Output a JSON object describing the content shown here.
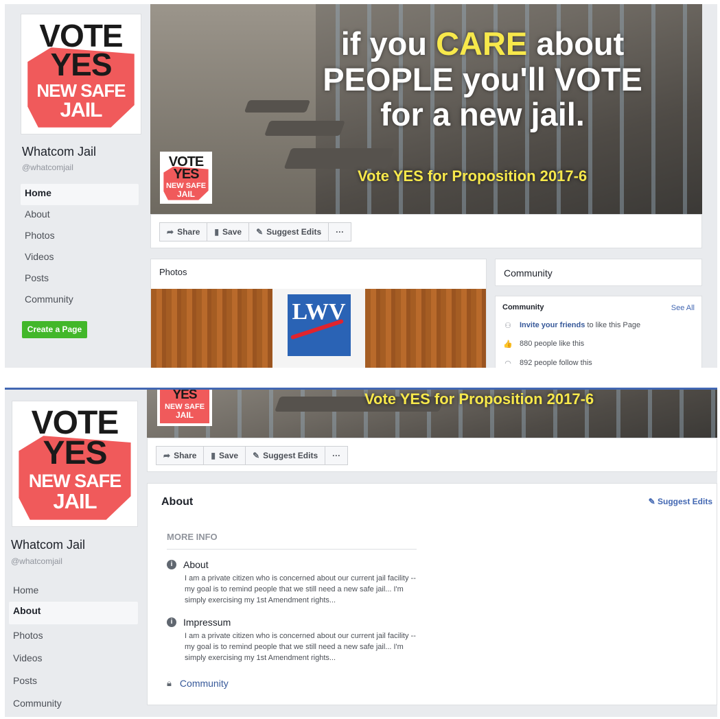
{
  "logo": {
    "line1": "VOTE",
    "line2": "YES",
    "line3": "NEW SAFE",
    "line4": "JAIL"
  },
  "page": {
    "name": "Whatcom Jail",
    "handle": "@whatcomjail"
  },
  "nav": [
    "Home",
    "About",
    "Photos",
    "Videos",
    "Posts",
    "Community"
  ],
  "create_page": "Create a Page",
  "cover": {
    "line1_pre": "if you ",
    "line1_hl": "CARE",
    "line1_post": " about",
    "line2": "PEOPLE you'll VOTE",
    "line3": "for a new jail.",
    "sub": "Vote YES for Proposition 2017-6"
  },
  "actions": {
    "share": "Share",
    "save": "Save",
    "suggest": "Suggest Edits",
    "more": "···"
  },
  "photos": {
    "title": "Photos",
    "lwv": "LWV"
  },
  "community": {
    "header": "Community",
    "title": "Community",
    "see_all": "See All",
    "invite_link": "Invite your friends",
    "invite_rest": " to like this Page",
    "likes": "880 people like this",
    "follows": "892 people follow this"
  },
  "about": {
    "title": "About",
    "suggest": "Suggest Edits",
    "more_info": "MORE INFO",
    "about_label": "About",
    "about_text": "I am a private citizen who is concerned about our current jail facility -- my goal is to remind people that we still need a new safe jail... I'm simply exercising my 1st Amendment rights...",
    "impressum_label": "Impressum",
    "impressum_text": "I am a private citizen who is concerned about our current jail facility -- my goal is to remind people that we still need a new safe jail... I'm simply exercising my 1st Amendment rights...",
    "community_link": "Community"
  },
  "colors": {
    "accent": "#4267b2",
    "logo_red": "#f05a5b",
    "cover_yellow": "#f7e84b",
    "create_green": "#42b72a"
  }
}
